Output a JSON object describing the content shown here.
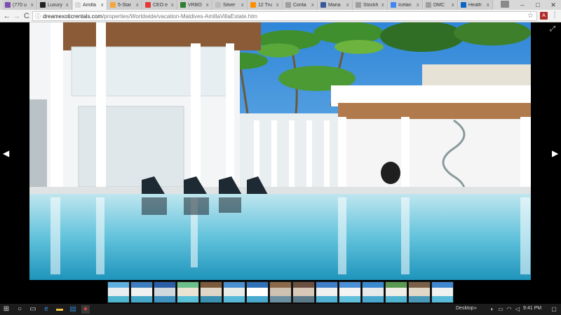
{
  "browser": {
    "tabs": [
      {
        "label": "(770 u",
        "color": "#7b4fb0"
      },
      {
        "label": "Luxury",
        "color": "#222222"
      },
      {
        "label": "Amilla",
        "color": "#d9d9d9",
        "active": true
      },
      {
        "label": "5-Star",
        "color": "#f3a73b"
      },
      {
        "label": "CEO e",
        "color": "#e53935"
      },
      {
        "label": "VRBO",
        "color": "#2e7d32"
      },
      {
        "label": "Silver",
        "color": "#bdbdbd"
      },
      {
        "label": "12 Tru",
        "color": "#ff8f00"
      },
      {
        "label": "Conta",
        "color": "#9e9e9e"
      },
      {
        "label": "Maria",
        "color": "#3b5998"
      },
      {
        "label": "Stockh",
        "color": "#9e9e9e"
      },
      {
        "label": "Icelan",
        "color": "#4285f4"
      },
      {
        "label": "DMC",
        "color": "#9e9e9e"
      },
      {
        "label": "Heath",
        "color": "#0a66c2"
      }
    ],
    "tab_close": "x",
    "window_controls": {
      "minimize": "–",
      "maximize": "□",
      "close": "✕"
    },
    "nav": {
      "back": "←",
      "forward": "→",
      "reload": "C"
    },
    "url_domain": "dreamexoticrentals.com",
    "url_path": "/properties/Worldwide/vacation-Maldives-AmillaVillaEstate.htm",
    "info_icon": "ⓘ",
    "bookmark_icon": "☆",
    "extension_label": "A",
    "menu_icon": "⋮"
  },
  "viewer": {
    "prev_arrow": "◀",
    "next_arrow": "▶",
    "expand_icon": "⤢",
    "thumbnail_count": 15
  },
  "taskbar": {
    "desktop_label": "Desktop",
    "chevron": "»",
    "time": "9:41 PM",
    "colors": {
      "start": "#ffffff",
      "edge": "#3c8ee0",
      "explorer": "#f0c64a",
      "store": "#2f86d3",
      "chrome": "#db4437"
    }
  }
}
